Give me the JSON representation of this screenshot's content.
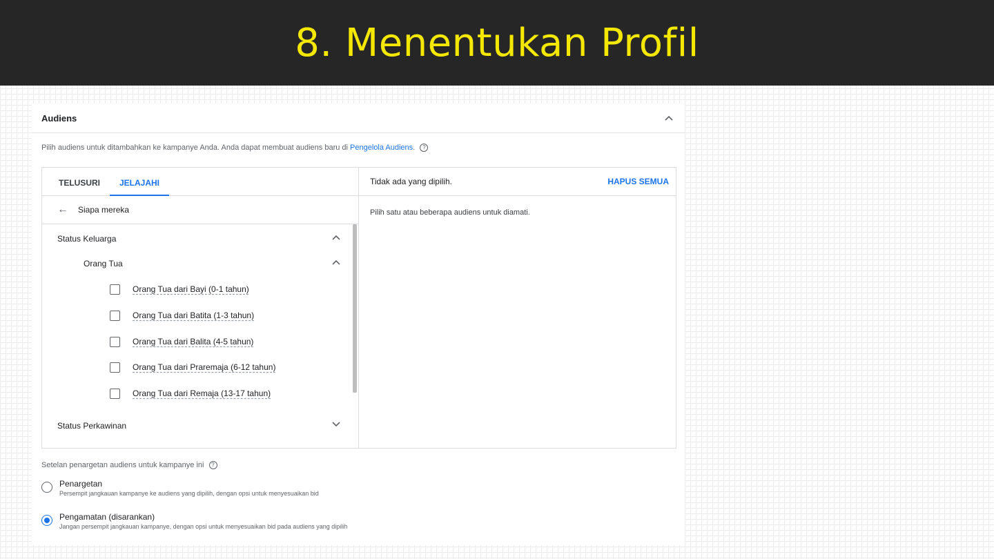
{
  "banner": {
    "title": "8.  Menentukan Profil"
  },
  "card": {
    "title": "Audiens",
    "description_prefix": "Pilih audiens untuk ditambahkan ke kampanye Anda. Anda dapat membuat audiens baru di ",
    "description_link": "Pengelola Audiens",
    "description_suffix": "."
  },
  "tabs": [
    {
      "label": "TELUSURI",
      "active": false
    },
    {
      "label": "JELAJAHI",
      "active": true
    }
  ],
  "browse": {
    "back_label": "Siapa mereka",
    "category": "Status Keluarga",
    "subcategory": "Orang Tua",
    "options": [
      "Orang Tua dari Bayi (0-1 tahun)",
      "Orang Tua dari Batita (1-3 tahun)",
      "Orang Tua dari Balita (4-5 tahun)",
      "Orang Tua dari Praremaja (6-12 tahun)",
      "Orang Tua dari Remaja (13-17 tahun)"
    ],
    "next_category": "Status Perkawinan"
  },
  "selected": {
    "none_label": "Tidak ada yang dipilih.",
    "clear_all": "HAPUS SEMUA",
    "hint": "Pilih satu atau beberapa audiens untuk diamati."
  },
  "targeting": {
    "title": "Setelan penargetan audiens untuk kampanye ini",
    "options": [
      {
        "label": "Penargetan",
        "sub": "Persempit jangkauan kampanye ke audiens yang dipilih, dengan opsi untuk menyesuaikan bid",
        "selected": false
      },
      {
        "label": "Pengamatan (disarankan)",
        "sub": "Jangan persempit jangkauan kampanye, dengan opsi untuk menyesuaikan bid pada audiens yang dipilih",
        "selected": true
      }
    ]
  },
  "colors": {
    "banner_bg": "#262626",
    "banner_text": "#f5e800",
    "accent": "#1a73e8"
  }
}
